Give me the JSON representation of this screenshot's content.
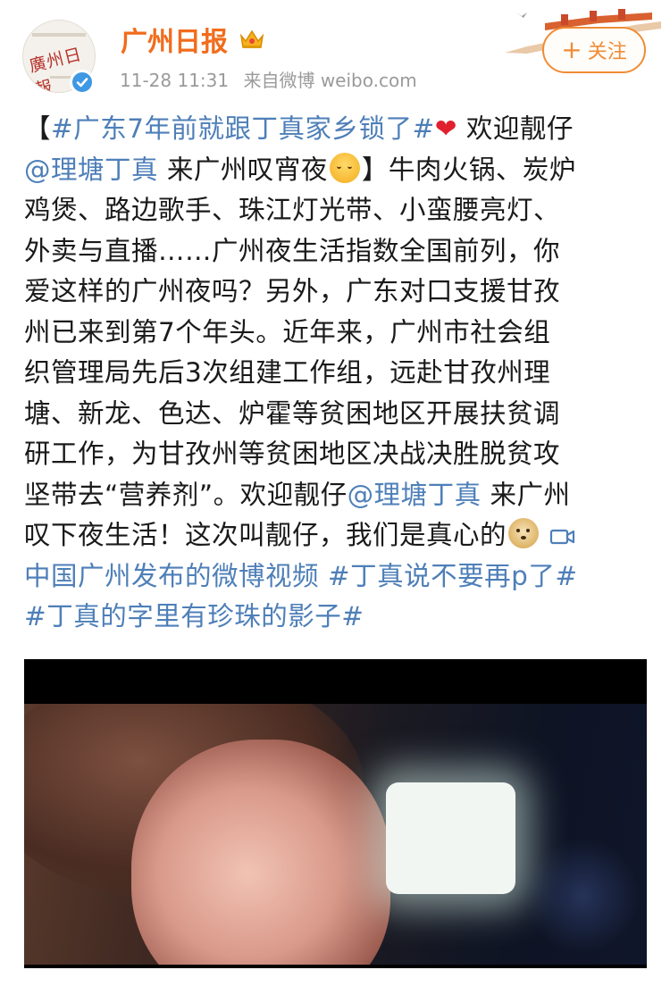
{
  "post": {
    "username": "广州日报",
    "timestamp": "11-28 11:31",
    "source": "来自微博 weibo.com",
    "follow_label": "+关注",
    "follow_text": "关注",
    "avatar_text": "廣州日報"
  },
  "content": {
    "l1_a": "【",
    "l1_tag": "#广东7年前就跟丁真家乡锁了#",
    "l1_heart": "❤",
    "l1_b": " 欢迎靓仔",
    "l2_mention": "@理塘丁真",
    "l2_a": " 来广州叹宵夜",
    "l2_b": "】牛肉火锅、炭炉",
    "l3": "鸡煲、路边歌手、珠江灯光带、小蛮腰亮灯、",
    "l4": "外卖与直播……广州夜生活指数全国前列，你",
    "l5": "爱这样的广州夜吗？另外，广东对口支援甘孜",
    "l6": "州已来到第7个年头。近年来，广州市社会组",
    "l7": "织管理局先后3次组建工作组，远赴甘孜州理",
    "l8": "塘、新龙、色达、炉霍等贫困地区开展扶贫调",
    "l9": "研工作，为甘孜州等贫困地区决战决胜脱贫攻",
    "l10_a": "坚带去“营养剂”。欢迎靓仔",
    "l10_mention": "@理塘丁真",
    "l10_b": " 来广州",
    "l11": "叹下夜生活！这次叫靓仔，我们是真心的",
    "l12_link": "中国广州发布的微博视频",
    "l12_tag": " #丁真说不要再p了#",
    "l13_tag": "#丁真的字里有珍珠的影子#"
  },
  "icons": {
    "verified": "verified-icon",
    "crown": "crown-icon",
    "blush_emoji": "blush-emoji-icon",
    "doge_emoji": "doge-emoji-icon",
    "video": "video-camera-icon"
  },
  "colors": {
    "username": "#f16c1d",
    "link": "#4e7fb8",
    "follow": "#f08c35",
    "meta": "#9a9a9a"
  }
}
